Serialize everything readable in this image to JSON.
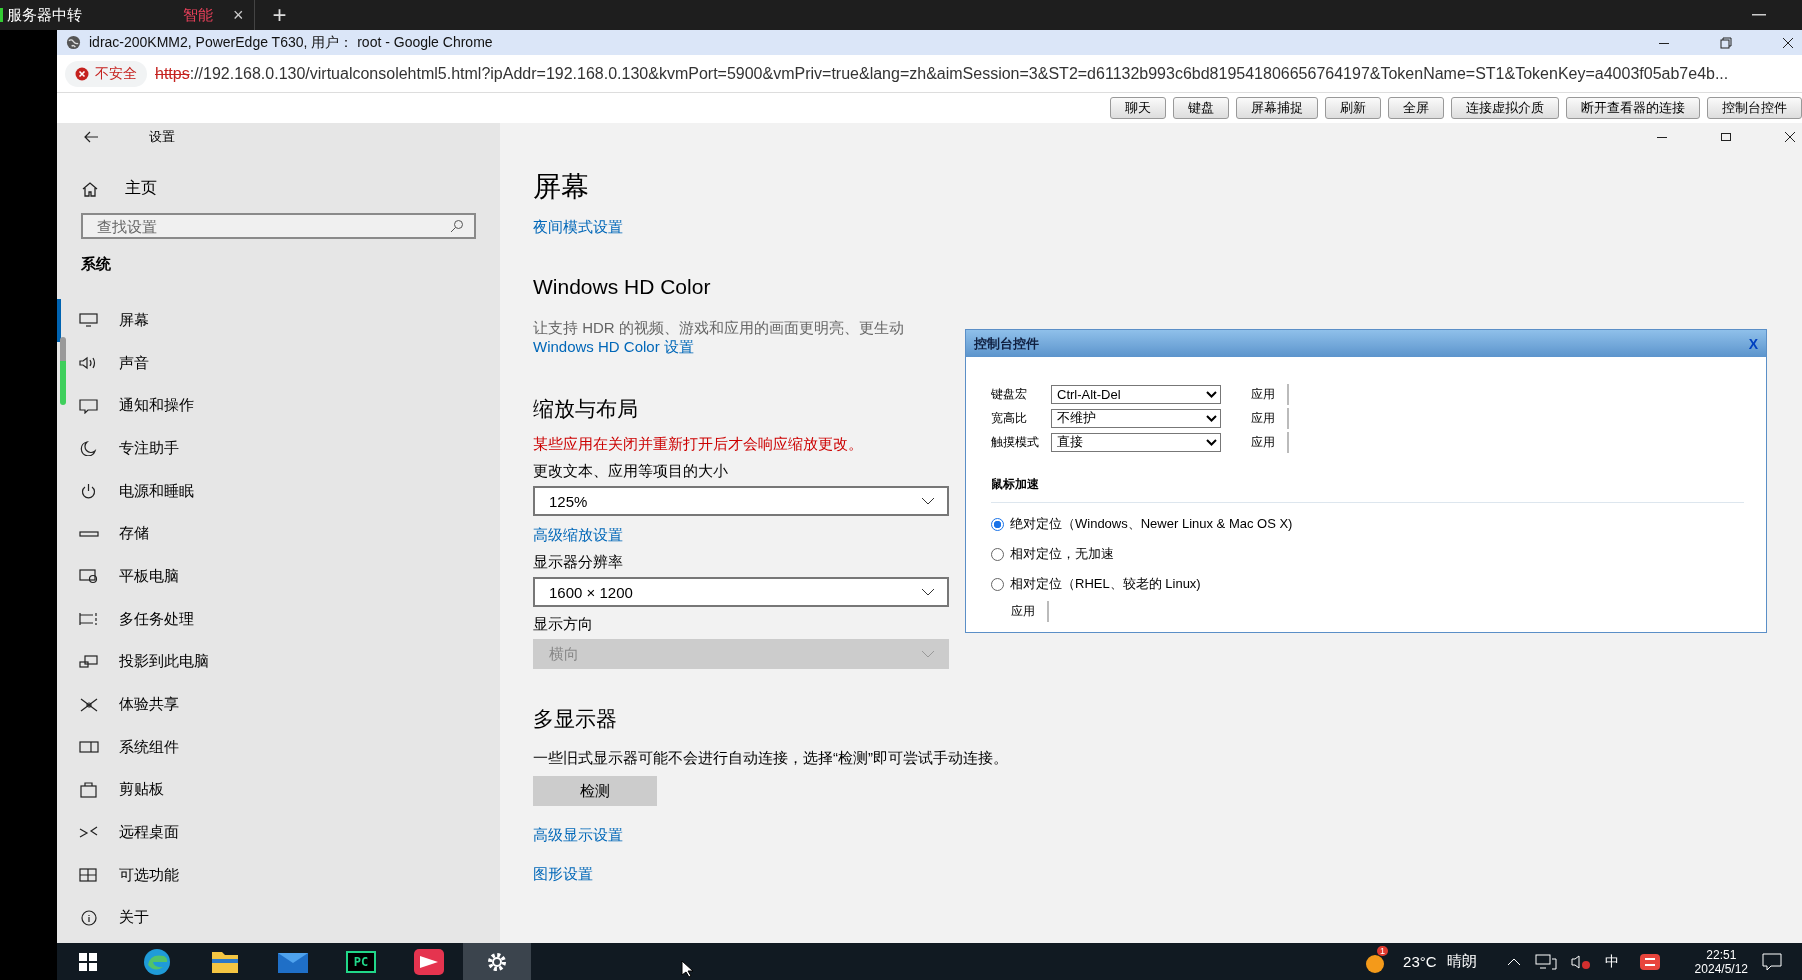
{
  "outer_bar": {
    "app_title": "服务器中转",
    "tabs": [
      {
        "label": "智能",
        "selected": true,
        "close": "×"
      }
    ],
    "new_tab": "+"
  },
  "browser": {
    "title": "idrac-200KMM2, PowerEdge T630, 用户：  root - Google Chrome",
    "security": "不安全",
    "url_scheme": "https",
    "url_rest": "://192.168.0.130/virtualconsolehtml5.html?ipAddr=192.168.0.130&kvmPort=5900&vmPriv=true&lang=zh&aimSession=3&ST2=d61132b993c6bd819541806656764197&TokenName=ST1&TokenKey=a4003f05ab7e4b..."
  },
  "toolbar_buttons": [
    "聊天",
    "键盘",
    "屏幕捕捉",
    "刷新",
    "全屏",
    "连接虚拟介质",
    "断开查看器的连接",
    "控制台控件"
  ],
  "settings": {
    "title": "设置",
    "home": "主页",
    "search": {
      "placeholder": "查找设置"
    },
    "section": "系统",
    "items": [
      {
        "label": "屏幕",
        "selected": true
      },
      {
        "label": "声音",
        "selected": false
      },
      {
        "label": "通知和操作",
        "selected": false
      },
      {
        "label": "专注助手",
        "selected": false
      },
      {
        "label": "电源和睡眠",
        "selected": false
      },
      {
        "label": "存储",
        "selected": false
      },
      {
        "label": "平板电脑",
        "selected": false
      },
      {
        "label": "多任务处理",
        "selected": false
      },
      {
        "label": "投影到此电脑",
        "selected": false
      },
      {
        "label": "体验共享",
        "selected": false
      },
      {
        "label": "系统组件",
        "selected": false
      },
      {
        "label": "剪贴板",
        "selected": false
      },
      {
        "label": "远程桌面",
        "selected": false
      },
      {
        "label": "可选功能",
        "selected": false
      },
      {
        "label": "关于",
        "selected": false
      }
    ],
    "page": {
      "heading": "屏幕",
      "night_link": "夜间模式设置",
      "hd_heading": "Windows HD Color",
      "hd_desc": "让支持 HDR 的视频、游戏和应用的画面更明亮、更生动",
      "hd_link": "Windows HD Color 设置",
      "scale_heading": "缩放与布局",
      "scale_warning": "某些应用在关闭并重新打开后才会响应缩放更改。",
      "dropdowns": [
        {
          "label": "更改文本、应用等项目的大小",
          "value": "125%",
          "disabled": false,
          "link": "高级缩放设置"
        },
        {
          "label": "显示器分辨率",
          "value": "1600 × 1200",
          "disabled": false
        },
        {
          "label": "显示方向",
          "value": "横向",
          "disabled": true
        }
      ],
      "multi_heading": "多显示器",
      "multi_desc": "一些旧式显示器可能不会进行自动连接，选择“检测”即可尝试手动连接。",
      "detect_button": "检测",
      "links": [
        "高级显示设置",
        "图形设置"
      ]
    }
  },
  "dialog": {
    "title": "控制台控件",
    "close": "X",
    "rows": [
      {
        "label": "键盘宏",
        "value": "Ctrl-Alt-Del",
        "apply": "应用"
      },
      {
        "label": "宽高比",
        "value": "不维护",
        "apply": "应用"
      },
      {
        "label": "触摸模式",
        "value": "直接",
        "apply": "应用"
      }
    ],
    "mouse_heading": "鼠标加速",
    "radios": [
      {
        "label": "绝对定位（Windows、Newer Linux & Mac OS X)",
        "selected": true
      },
      {
        "label": "相对定位，无加速",
        "selected": false
      },
      {
        "label": "相对定位（RHEL、较老的 Linux)",
        "selected": false
      }
    ],
    "apply": "应用"
  },
  "taskbar": {
    "apps": [
      {
        "active": false
      },
      {
        "active": false
      },
      {
        "active": false
      },
      {
        "label": "PC",
        "active": false
      },
      {
        "active": false
      },
      {
        "active": true
      }
    ],
    "weather": {
      "badge": "1",
      "temp": "23°C",
      "desc": "晴朗"
    },
    "ime": "中",
    "time": "22:51",
    "date": "2024/5/12"
  }
}
